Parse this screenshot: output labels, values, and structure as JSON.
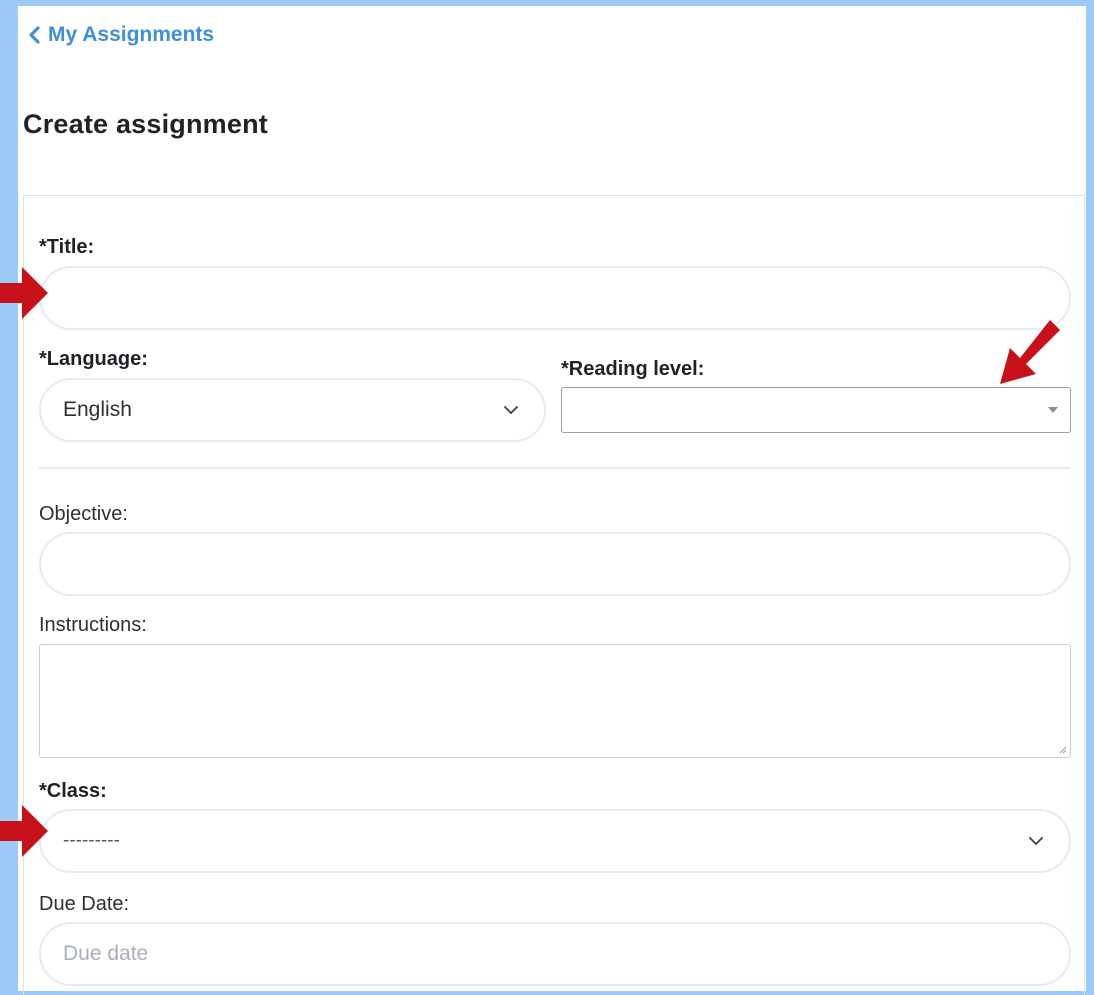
{
  "nav": {
    "back_label": "My Assignments"
  },
  "page": {
    "title": "Create assignment"
  },
  "form": {
    "title_label": "*Title:",
    "title_value": "",
    "language_label": "*Language:",
    "language_value": "English",
    "reading_level_label": "*Reading level:",
    "reading_level_value": "",
    "objective_label": "Objective:",
    "objective_value": "",
    "instructions_label": "Instructions:",
    "instructions_value": "",
    "class_label": "*Class:",
    "class_value": "---------",
    "due_date_label": "Due Date:",
    "due_date_placeholder": "Due date"
  },
  "icons": {
    "back": "chevron-left-icon",
    "dropdown": "chevron-down-icon",
    "caret": "caret-down-icon",
    "annotation": "red-arrow-icon"
  },
  "colors": {
    "frame_background": "#9cc9f6",
    "link": "#3f8fd8",
    "annotation_arrow": "#c8101a",
    "field_border": "#e3ebf5"
  }
}
